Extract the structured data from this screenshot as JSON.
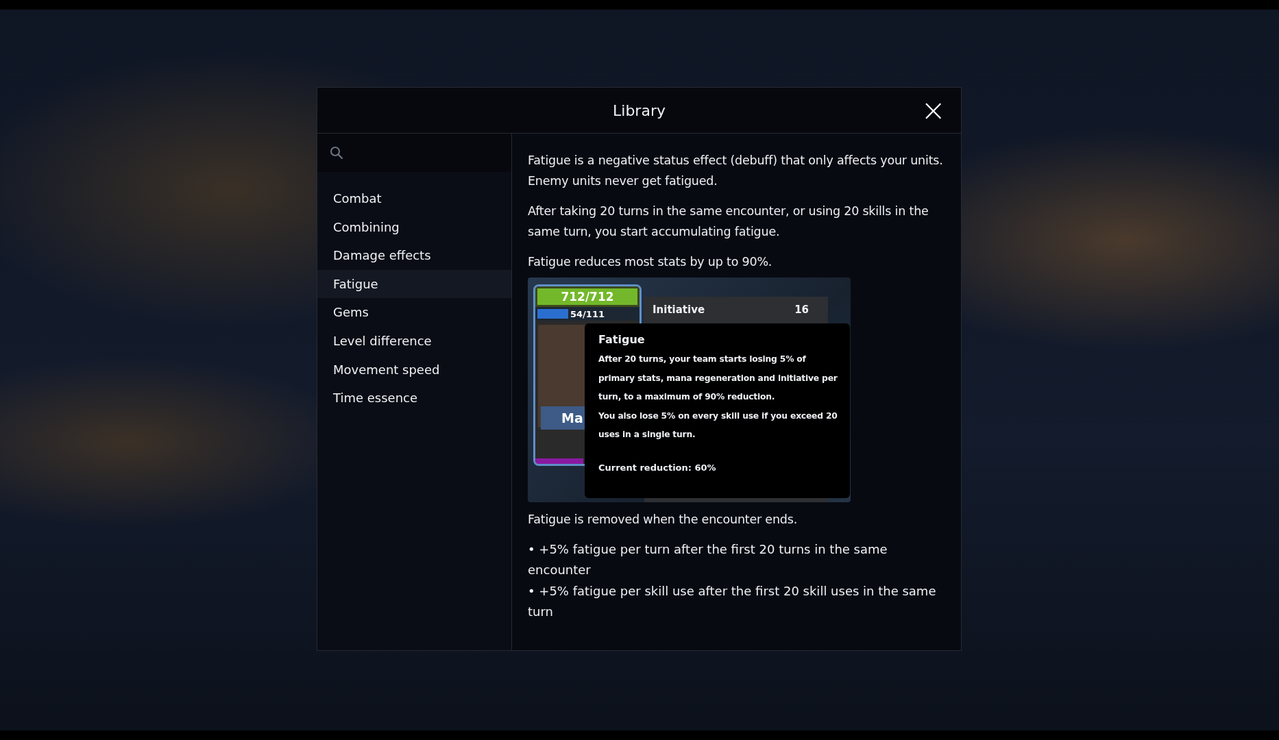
{
  "dialog": {
    "title": "Library",
    "close": "×"
  },
  "sidebar": {
    "items": [
      {
        "label": "Combat",
        "selected": false
      },
      {
        "label": "Combining",
        "selected": false
      },
      {
        "label": "Damage effects",
        "selected": false
      },
      {
        "label": "Fatigue",
        "selected": true
      },
      {
        "label": "Gems",
        "selected": false
      },
      {
        "label": "Level difference",
        "selected": false
      },
      {
        "label": "Movement speed",
        "selected": false
      },
      {
        "label": "Time essence",
        "selected": false
      }
    ]
  },
  "article": {
    "intro": [
      "Fatigue is a negative status effect (debuff) that only affects your units. Enemy units never get fatigued.",
      "After taking 20 turns in the same encounter, or using 20 skills in the same turn, you start accumulating fatigue.",
      "Fatigue reduces most stats by up to 90%."
    ],
    "image": {
      "health": {
        "reading": "712/712",
        "level": 1
      },
      "mana": {
        "reading": "54/111",
        "level": 0.49
      },
      "name": "Ma",
      "stat": {
        "label": "Initiative",
        "value": "16"
      },
      "tooltip": {
        "title": "Fatigue",
        "lines": [
          "After 20 turns, your team starts losing 5% of primary stats, mana regeneration and initiative per turn, to a maximum of 90% reduction.",
          "You also lose 5% on every skill use if you exceed 20 uses in a single turn."
        ],
        "footer": "Current reduction: 60%"
      }
    },
    "outro": [
      "Fatigue is removed when the encounter ends."
    ],
    "bullets": [
      "• +5% fatigue per turn after the first 20 turns in the same encounter",
      "• +5% fatigue per skill use after the first 20 skill uses in the same turn"
    ]
  }
}
